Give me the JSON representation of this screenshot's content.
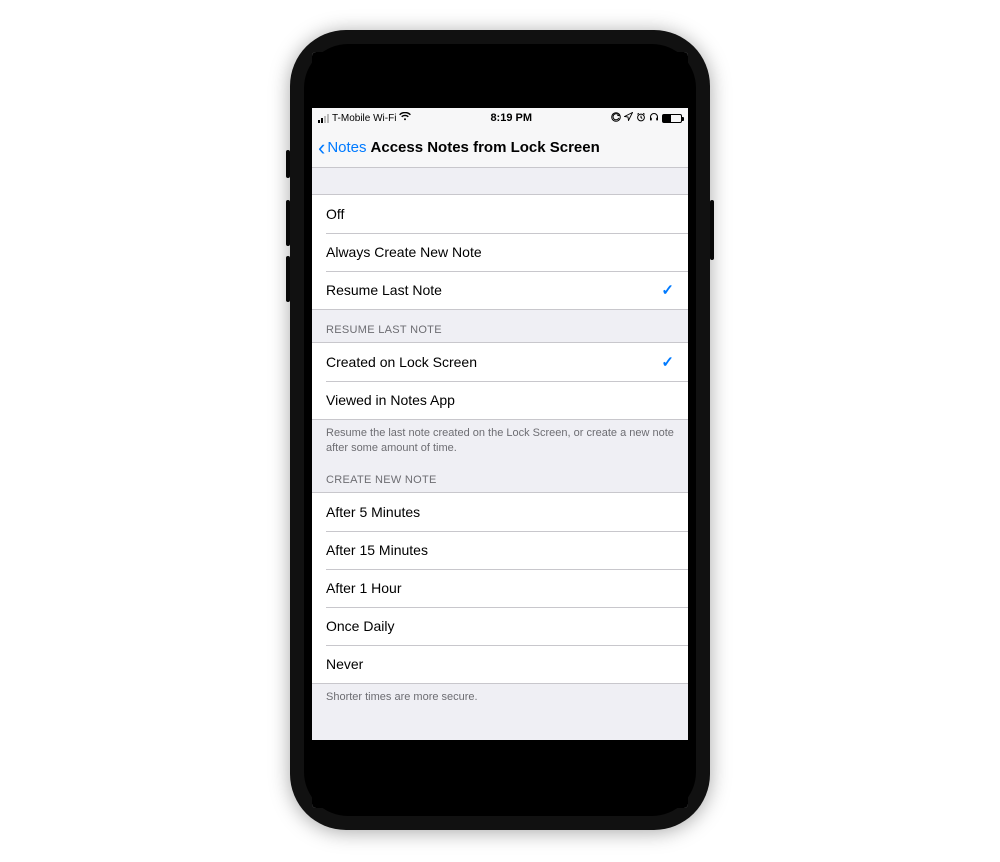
{
  "status": {
    "carrier": "T-Mobile Wi-Fi",
    "time": "8:19 PM",
    "icons": {
      "orientation_lock": "⊘",
      "location": "➤",
      "alarm": "⏰",
      "headphones": "🎧"
    }
  },
  "nav": {
    "back_label": "Notes",
    "title": "Access Notes from Lock Screen"
  },
  "section_top": {
    "items": [
      {
        "label": "Off",
        "selected": false
      },
      {
        "label": "Always Create New Note",
        "selected": false
      },
      {
        "label": "Resume Last Note",
        "selected": true
      }
    ]
  },
  "section_resume": {
    "header": "RESUME LAST NOTE",
    "items": [
      {
        "label": "Created on Lock Screen",
        "selected": true
      },
      {
        "label": "Viewed in Notes App",
        "selected": false
      }
    ],
    "footer": "Resume the last note created on the Lock Screen, or create a new note after some amount of time."
  },
  "section_create": {
    "header": "CREATE NEW NOTE",
    "items": [
      {
        "label": "After 5 Minutes",
        "selected": false
      },
      {
        "label": "After 15 Minutes",
        "selected": false
      },
      {
        "label": "After 1 Hour",
        "selected": false
      },
      {
        "label": "Once Daily",
        "selected": false
      },
      {
        "label": "Never",
        "selected": false
      }
    ],
    "footer": "Shorter times are more secure."
  },
  "checkmark": "✓"
}
